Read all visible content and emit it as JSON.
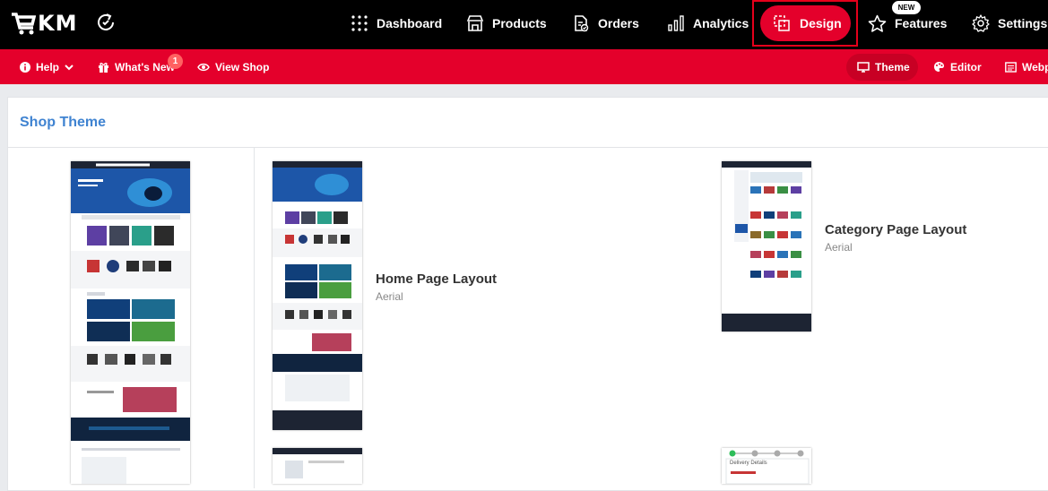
{
  "brand": {
    "logo_text": "KM"
  },
  "nav": {
    "dashboard": "Dashboard",
    "products": "Products",
    "orders": "Orders",
    "analytics": "Analytics",
    "design": "Design",
    "features": "Features",
    "features_badge": "NEW",
    "settings": "Settings"
  },
  "subnav": {
    "help": "Help",
    "whats_new": "What's New",
    "whats_new_count": "1",
    "view_shop": "View Shop",
    "theme": "Theme",
    "editor": "Editor",
    "webpages": "Webp"
  },
  "main": {
    "title": "Shop Theme",
    "layouts": [
      {
        "name": "Home Page Layout",
        "theme": "Aerial"
      },
      {
        "name": "Category Page Layout",
        "theme": "Aerial"
      }
    ],
    "checkout_preview_label": "Delivery Details"
  },
  "colors": {
    "brand_red": "#e4002b",
    "title_blue": "#3f83d1",
    "topbar": "#000000"
  }
}
